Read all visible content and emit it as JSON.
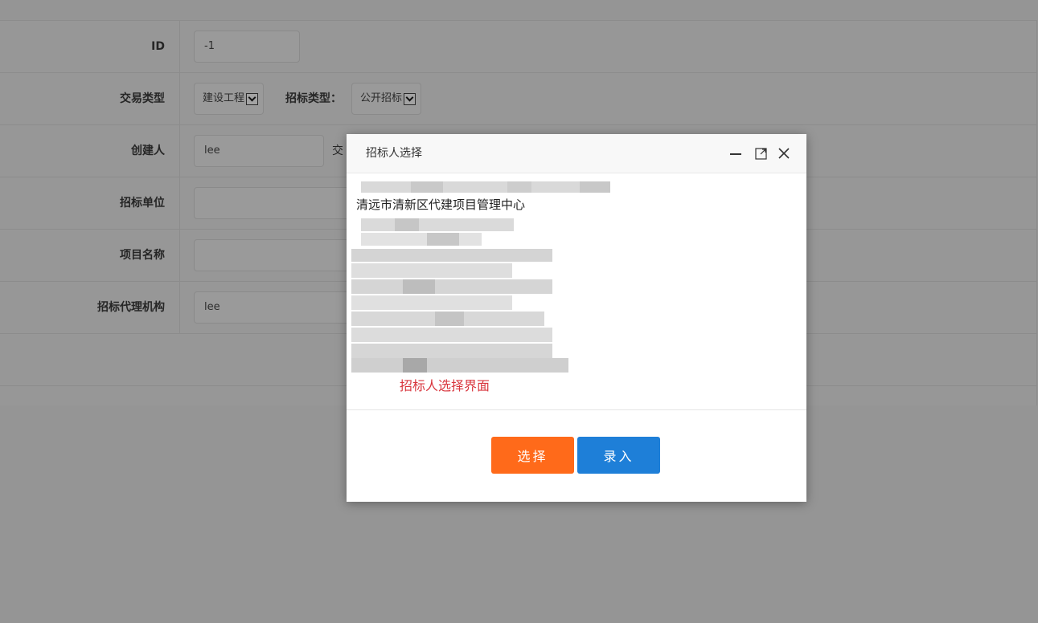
{
  "form": {
    "rows": [
      {
        "label": "ID",
        "value": "-1"
      },
      {
        "label": "交易类型",
        "select1": "建设工程",
        "inline_label": "招标类型：",
        "select2": "公开招标"
      },
      {
        "label": "创建人",
        "value": "lee",
        "trailing": "交"
      },
      {
        "label": "招标单位",
        "value": ""
      },
      {
        "label": "项目名称",
        "value": ""
      },
      {
        "label": "招标代理机构",
        "value": "lee"
      }
    ]
  },
  "modal": {
    "title": "招标人选择",
    "org_visible": "清远市清新区代建项目管理中心",
    "note": "招标人选择界面",
    "select_label": "选择",
    "enter_label": "录入",
    "minimize_icon": "minimize-icon",
    "maximize_icon": "maximize-icon",
    "close_icon": "close-icon"
  },
  "colors": {
    "overlay": "#959595",
    "select_button": "#ff6a1a",
    "enter_button": "#1e7fd8",
    "note_text": "#d9363e"
  }
}
